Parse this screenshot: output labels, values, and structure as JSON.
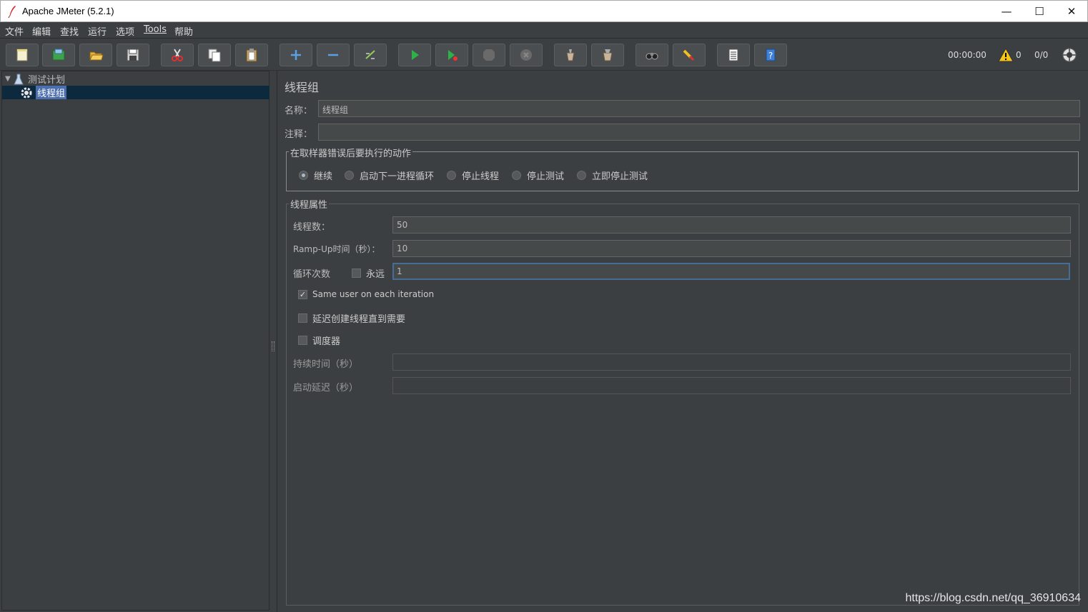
{
  "window": {
    "title": "Apache JMeter (5.2.1)",
    "minimize": "—",
    "maximize": "☐",
    "close": "✕"
  },
  "menu": {
    "items": [
      "文件",
      "编辑",
      "查找",
      "运行",
      "选项",
      "Tools",
      "帮助"
    ]
  },
  "toolbar": {
    "icons": [
      "new-icon",
      "templates-icon",
      "open-icon",
      "save-icon",
      "cut-icon",
      "copy-icon",
      "paste-icon",
      "expand-icon",
      "collapse-icon",
      "toggle-icon",
      "start-icon",
      "start-no-pause-icon",
      "stop-icon",
      "shutdown-icon",
      "clear-icon",
      "clear-all-icon",
      "search-icon",
      "reset-search-icon",
      "function-helper-icon",
      "help-icon"
    ],
    "timer": "00:00:00",
    "warning_count": "0",
    "threads": "0/0"
  },
  "tree": {
    "root": "测试计划",
    "child": "线程组"
  },
  "main": {
    "title": "线程组",
    "name_label": "名称：",
    "name_value": "线程组",
    "comment_label": "注释：",
    "comment_value": "",
    "error_group_title": "在取样器错误后要执行的动作",
    "error_actions": [
      "继续",
      "启动下一进程循环",
      "停止线程",
      "停止测试",
      "立即停止测试"
    ],
    "error_selected": 0,
    "props_title": "线程属性",
    "threads_label": "线程数：",
    "threads_value": "50",
    "rampup_label": "Ramp-Up时间（秒）：",
    "rampup_value": "10",
    "loop_label": "循环次数",
    "forever_label": "永远",
    "loop_value": "1",
    "same_user_label": "Same user on each iteration",
    "delay_label": "延迟创建线程直到需要",
    "scheduler_label": "调度器",
    "duration_label": "持续时间（秒）",
    "duration_value": "",
    "startup_delay_label": "启动延迟（秒）",
    "startup_delay_value": ""
  },
  "watermark": "https://blog.csdn.net/qq_36910634",
  "colors": {
    "background": "#3c3f41",
    "field": "#45494a",
    "selection": "#4b6eaf",
    "focus_border": "#466d94"
  }
}
